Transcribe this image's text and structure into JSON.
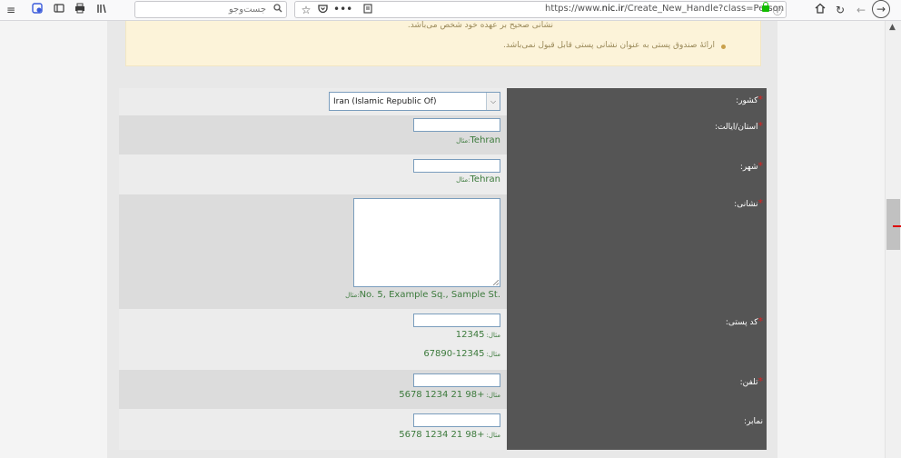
{
  "browser": {
    "search_placeholder": "جست‌وجو",
    "url_prefix": "https://www.",
    "url_domain": "nic.ir",
    "url_path": "/Create_New_Handle?class=Person",
    "icons": [
      "menu-icon",
      "shield-badge-icon",
      "reader-view-icon",
      "print-icon",
      "library-icon",
      "star-icon",
      "pocket-icon",
      "more-icon",
      "reader-mode-icon",
      "home-icon",
      "reload-icon",
      "back-icon",
      "forward-icon"
    ]
  },
  "notice": {
    "line1": "نشانی صحیح بر عهده خود شخص می‌باشد.",
    "line2": "ارائهٔ صندوق پستی به عنوان نشانی پستی قابل قبول نمی‌باشد."
  },
  "form": {
    "country": {
      "label": "کشور:",
      "required": "*",
      "value": "Iran (Islamic Republic Of)"
    },
    "province": {
      "label": "استان/ایالت:",
      "required": "*",
      "hint_prefix": "مثال:",
      "hint": "Tehran"
    },
    "city": {
      "label": "شهر:",
      "required": "*",
      "hint_prefix": "مثال:",
      "hint": "Tehran"
    },
    "address": {
      "label": "نشانی:",
      "required": "*",
      "hint_prefix": "مثال:",
      "hint": "No. 5, Example Sq., Sample St."
    },
    "postal": {
      "label": "کد پستی:",
      "required": "*",
      "hint_prefix": "مثال:",
      "hint": "12345",
      "hint2_prefix": "مثال:",
      "hint2": "12345-67890"
    },
    "phone": {
      "label": "تلفن:",
      "required": "*",
      "hint_prefix": "مثال:",
      "hint": "+98 21 1234 5678"
    },
    "fax": {
      "label": "نمابر:",
      "hint_prefix": "مثال:",
      "hint": "+98 21 1234 5678"
    }
  },
  "colors": {
    "label_bg": "#555555",
    "hint_green": "#3c7a3c",
    "required_red": "#e02020",
    "notice_bg": "#fcf3d9"
  }
}
